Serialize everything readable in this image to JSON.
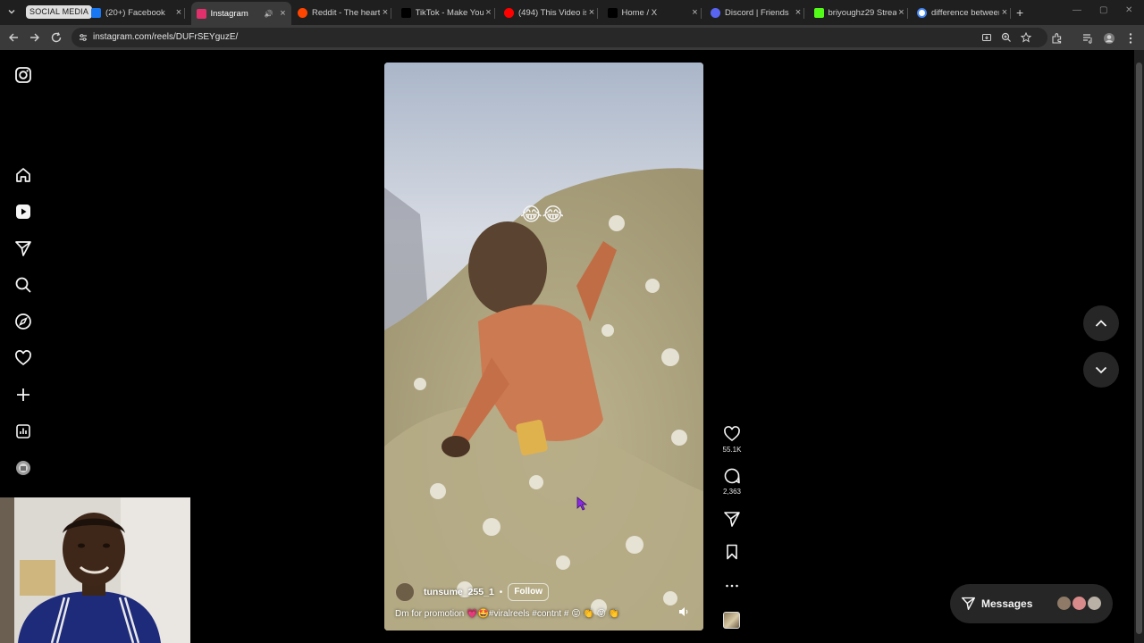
{
  "browser": {
    "tab_group_label": "SOCIAL MEDIA",
    "tabs": [
      {
        "title": "(20+) Facebook",
        "icon": "facebook-icon",
        "color": "#1877f2"
      },
      {
        "title": "Instagram",
        "icon": "instagram-icon",
        "color": "#e1306c",
        "active": true
      },
      {
        "title": "Reddit - The heart",
        "icon": "reddit-icon",
        "color": "#ff4500"
      },
      {
        "title": "TikTok - Make You",
        "icon": "tiktok-icon",
        "color": "#000000"
      },
      {
        "title": "(494) This Video is",
        "icon": "youtube-icon",
        "color": "#ff0000"
      },
      {
        "title": "Home / X",
        "icon": "x-icon",
        "color": "#000000"
      },
      {
        "title": "Discord | Friends",
        "icon": "discord-icon",
        "color": "#5865f2"
      },
      {
        "title": "briyoughz29 Strea",
        "icon": "kick-icon",
        "color": "#53fc18"
      },
      {
        "title": "difference between",
        "icon": "google-icon",
        "color": "#ffffff"
      }
    ],
    "url": "instagram.com/reels/DUFrSEYguzE/"
  },
  "reel": {
    "emoji": "😂😂",
    "author": "tunsume_255_1",
    "separator": "•",
    "follow_label": "Follow",
    "caption": "Dm for promotion 💗🤩#viralreels #contnt # 😝 👏 😝 👏",
    "likes": "55.1K",
    "comments": "2,363"
  },
  "messages": {
    "label": "Messages"
  },
  "colors": {
    "page_bg": "#000000",
    "button_bg": "#262626",
    "chrome_dark": "#1f1f1f",
    "chrome_toolbar": "#3a3a3a"
  }
}
